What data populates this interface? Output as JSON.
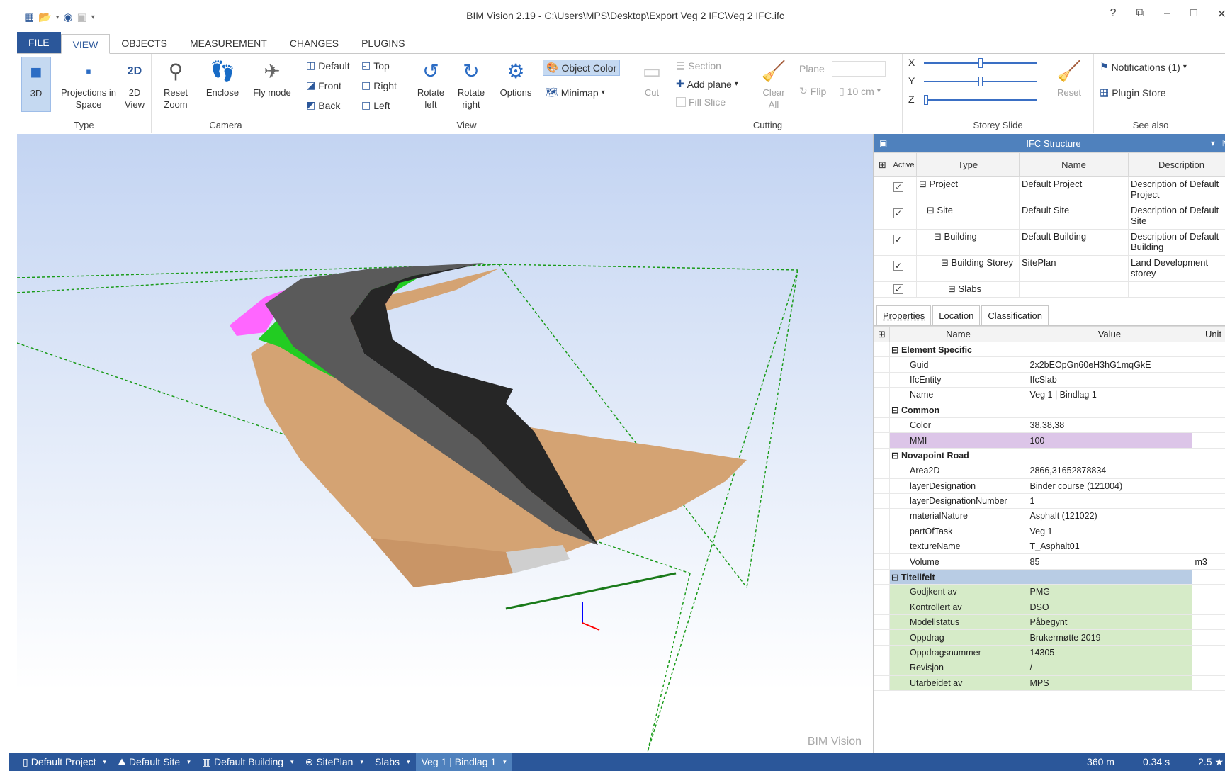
{
  "title": "BIM Vision 2.19 - C:\\Users\\MPS\\Desktop\\Export Veg 2 IFC\\Veg 2 IFC.ifc",
  "window_controls": {
    "help": "?",
    "minimize": "–",
    "maximize": "□",
    "close": "✕"
  },
  "tabs": [
    "FILE",
    "VIEW",
    "OBJECTS",
    "MEASUREMENT",
    "CHANGES",
    "PLUGINS"
  ],
  "ribbon": {
    "type_group": {
      "label": "Type",
      "btn_3d": "3D",
      "projections": "Projections in Space",
      "view2d": "2D View"
    },
    "camera_group": {
      "label": "Camera",
      "reset_zoom": "Reset Zoom",
      "enclose": "Enclose",
      "fly_mode": "Fly mode"
    },
    "view_group": {
      "label": "View",
      "default": "Default",
      "top": "Top",
      "front": "Front",
      "right": "Right",
      "back": "Back",
      "left": "Left",
      "rotate_left": "Rotate left",
      "rotate_right": "Rotate right",
      "options": "Options",
      "object_color": "Object Color",
      "minimap": "Minimap"
    },
    "cutting_group": {
      "label": "Cutting",
      "cut": "Cut",
      "section": "Section",
      "add_plane": "Add plane",
      "fill_slice": "Fill Slice",
      "clear_all": "Clear All",
      "plane": "Plane",
      "flip": "Flip",
      "distance": "10 cm"
    },
    "storey_group": {
      "label": "Storey Slide",
      "x": "X",
      "y": "Y",
      "z": "Z",
      "reset": "Reset",
      "x_value": 0.5,
      "y_value": 0.5,
      "z_value": 0.0
    },
    "see_also_group": {
      "label": "See also",
      "notifications": "Notifications (1)",
      "plugin_store": "Plugin Store"
    }
  },
  "viewport": {
    "watermark": "BIM Vision"
  },
  "ifc_structure": {
    "title": "IFC Structure",
    "columns": [
      "Active",
      "Type",
      "Name",
      "Description"
    ],
    "rows": [
      {
        "type": "Project",
        "name": "Default Project",
        "desc": "Description of Default Project"
      },
      {
        "type": "Site",
        "name": "Default Site",
        "desc": "Description of Default Site"
      },
      {
        "type": "Building",
        "name": "Default Building",
        "desc": "Description of Default Building"
      },
      {
        "type": "Building Storey",
        "name": "SitePlan",
        "desc": "Land Development storey"
      },
      {
        "type": "Slabs",
        "name": "",
        "desc": ""
      }
    ]
  },
  "property_tabs": [
    "Properties",
    "Location",
    "Classification"
  ],
  "properties": {
    "columns": [
      "Name",
      "Value",
      "Unit"
    ],
    "groups": [
      {
        "name": "Element Specific",
        "rows": [
          {
            "name": "Guid",
            "value": "2x2bEOpGn60eH3hG1mqGkE",
            "unit": ""
          },
          {
            "name": "IfcEntity",
            "value": "IfcSlab",
            "unit": ""
          },
          {
            "name": "Name",
            "value": "Veg 1 | Bindlag 1",
            "unit": ""
          }
        ]
      },
      {
        "name": "Common",
        "rows": [
          {
            "name": "Color",
            "value": "38,38,38",
            "unit": ""
          },
          {
            "name": "MMI",
            "value": "100",
            "unit": ""
          }
        ]
      },
      {
        "name": "Novapoint Road",
        "rows": [
          {
            "name": "Area2D",
            "value": "2866,31652878834",
            "unit": ""
          },
          {
            "name": "layerDesignation",
            "value": "Binder course (121004)",
            "unit": ""
          },
          {
            "name": "layerDesignationNumber",
            "value": "1",
            "unit": ""
          },
          {
            "name": "materialNature",
            "value": "Asphalt (121022)",
            "unit": ""
          },
          {
            "name": "partOfTask",
            "value": "Veg 1",
            "unit": ""
          },
          {
            "name": "textureName",
            "value": "T_Asphalt01",
            "unit": ""
          },
          {
            "name": "Volume",
            "value": "85",
            "unit": "m3"
          }
        ]
      },
      {
        "name": "Titellfelt",
        "rows": [
          {
            "name": "Godjkent av",
            "value": "PMG",
            "unit": ""
          },
          {
            "name": "Kontrollert av",
            "value": "DSO",
            "unit": ""
          },
          {
            "name": "Modellstatus",
            "value": "Påbegynt",
            "unit": ""
          },
          {
            "name": "Oppdrag",
            "value": "Brukermøtte 2019",
            "unit": ""
          },
          {
            "name": "Oppdragsnummer",
            "value": "14305",
            "unit": ""
          },
          {
            "name": "Revisjon",
            "value": "/",
            "unit": ""
          },
          {
            "name": "Utarbeidet av",
            "value": "MPS",
            "unit": ""
          }
        ]
      }
    ]
  },
  "status_bar": {
    "crumbs": [
      "Default Project",
      "Default Site",
      "Default Building",
      "SitePlan",
      "Slabs",
      "Veg 1 | Bindlag 1"
    ],
    "distance": "360 m",
    "time": "0.34 s",
    "speed": "2.5 ★"
  },
  "colors": {
    "accent": "#2b579a",
    "panel_header": "#4f81bd",
    "mmi_row": "#dcc5e8",
    "titellfelt_rows": "#d6ebc8",
    "asphalt": "#262626",
    "terrain": "#d4a373",
    "edge": "#ff66ff",
    "grass": "#22cc22"
  }
}
